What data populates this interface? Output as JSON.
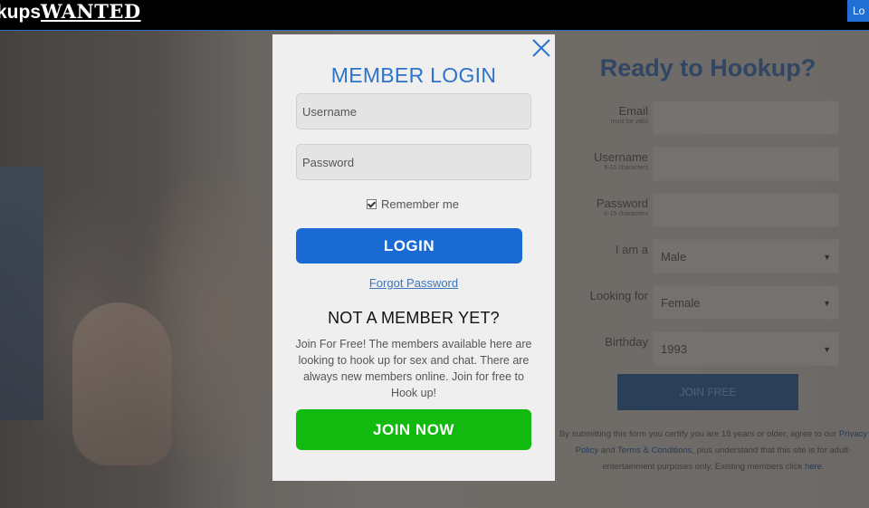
{
  "header": {
    "logo_prefix": "kups",
    "logo_suffix": "WANTED",
    "login_tab": "Lo"
  },
  "signup": {
    "title": "Ready to Hookup?",
    "fields": [
      {
        "label": "Email",
        "sub": "must be valid"
      },
      {
        "label": "Username",
        "sub": "6-15 characters"
      },
      {
        "label": "Password",
        "sub": "6-15 characters"
      }
    ],
    "selects": [
      {
        "label": "I am a",
        "value": "Male"
      },
      {
        "label": "Looking for",
        "value": "Female"
      },
      {
        "label": "Birthday",
        "value": "1993"
      }
    ],
    "join_button": "JOIN FREE",
    "disclaimer_1": "By submitting this form you certify you are 18 years or older, agree to our",
    "privacy_link": "Privacy Policy",
    "and_text": " and ",
    "terms_link": "Terms & Conditions",
    "disclaimer_2": ", plus understand that this site is for adult-entertainment purposes only. Existing members click ",
    "here_link": "here",
    "disclaimer_end": "."
  },
  "modal": {
    "title": "MEMBER LOGIN",
    "username_placeholder": "Username",
    "password_placeholder": "Password",
    "remember_label": "Remember me",
    "remember_checked": true,
    "login_button": "LOGIN",
    "forgot_link": "Forgot Password",
    "not_member_title": "NOT A MEMBER YET?",
    "not_member_text": "Join For Free! The members available here are looking to hook up for sex and chat. There are always new members online. Join for free to Hook up!",
    "join_button": "JOIN NOW",
    "close_icon": "close-icon"
  },
  "colors": {
    "modal_title": "#2d74c9",
    "login_button": "#1a6ad4",
    "join_button": "#12b90e",
    "signup_title": "#2b4d7a"
  }
}
